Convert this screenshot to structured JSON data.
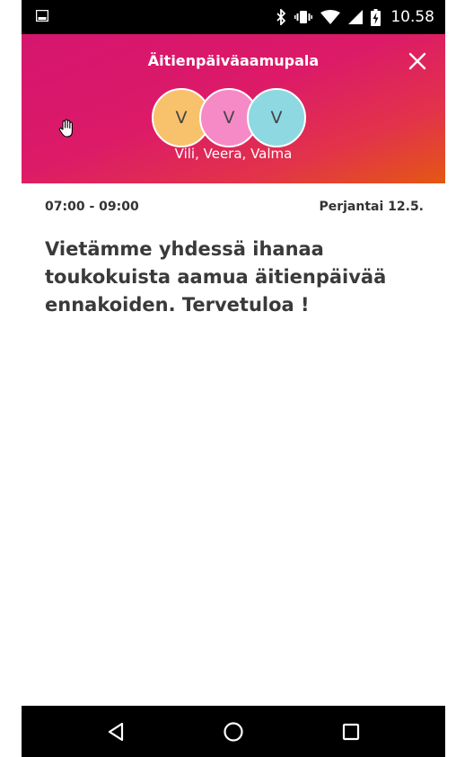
{
  "status_bar": {
    "time": "10.58",
    "icons": [
      "gallery-icon",
      "bluetooth-icon",
      "vibrate-icon",
      "wifi-icon",
      "signal-icon",
      "battery-charging-icon"
    ]
  },
  "header": {
    "title": "Äitienpäiväaamupala",
    "close_icon": "close-icon",
    "gradient_colors": [
      "#d6156f",
      "#e45713"
    ],
    "avatars": [
      {
        "initial": "V",
        "color": "#f8c26c"
      },
      {
        "initial": "V",
        "color": "#f58ac7"
      },
      {
        "initial": "V",
        "color": "#8ed8e2"
      }
    ],
    "names": "Vili, Veera, Valma"
  },
  "event": {
    "time_range": "07:00 - 09:00",
    "date": "Perjantai 12.5.",
    "description": "Vietämme yhdessä ihanaa\ntoukokuista aamua äitienpäivää\nennakoiden. Tervetuloa !"
  },
  "nav_bar": {
    "buttons": [
      "back-icon",
      "home-icon",
      "recents-icon"
    ]
  }
}
